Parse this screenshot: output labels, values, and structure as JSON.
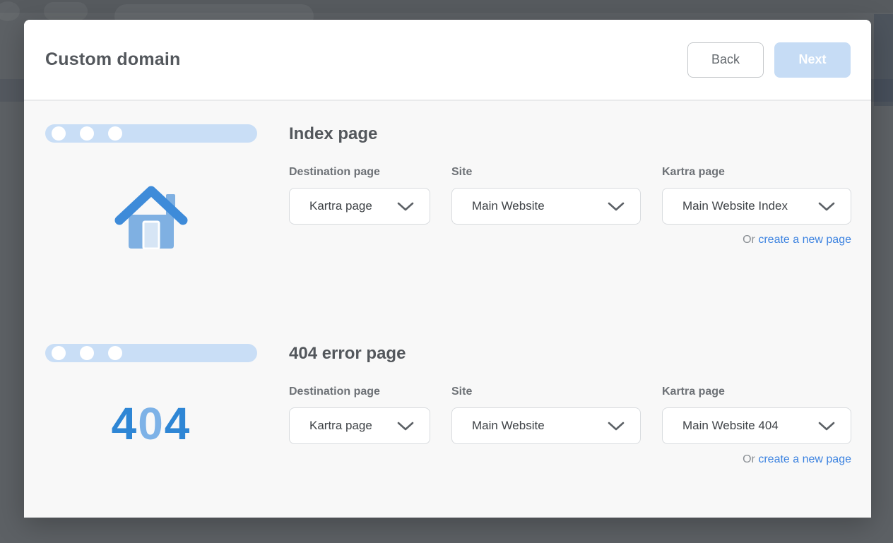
{
  "modal": {
    "title": "Custom domain",
    "back_label": "Back",
    "next_label": "Next"
  },
  "sections": [
    {
      "heading": "Index page",
      "illustration": "home-icon",
      "fields": [
        {
          "label": "Destination page",
          "value": "Kartra page"
        },
        {
          "label": "Site",
          "value": "Main Website"
        },
        {
          "label": "Kartra page",
          "value": "Main Website Index"
        }
      ],
      "or_text": "Or",
      "link_text": "create a new page"
    },
    {
      "heading": "404 error page",
      "illustration": "404-graphic",
      "digits": [
        "4",
        "0",
        "4"
      ],
      "fields": [
        {
          "label": "Destination page",
          "value": "Kartra page"
        },
        {
          "label": "Site",
          "value": "Main Website"
        },
        {
          "label": "Kartra page",
          "value": "Main Website 404"
        }
      ],
      "or_text": "Or",
      "link_text": "create a new page"
    }
  ],
  "colors": {
    "overlay": "#5d6165",
    "modal_header_bg": "#ffffff",
    "modal_body_bg": "#f8f8f8",
    "next_button_bg": "#c6dcf5",
    "back_button_border": "#c5c8cb",
    "browser_bar_blue": "#c9def6",
    "illustration_blue_dark": "#3e8bd9",
    "illustration_blue_light": "#7fb0e2",
    "not_found_dark": "#2e86d5",
    "not_found_light": "#7db2e7",
    "link_blue": "#3b82e0",
    "heading_text": "#53575c",
    "label_text": "#6d7176",
    "select_border": "#d8dbde"
  }
}
